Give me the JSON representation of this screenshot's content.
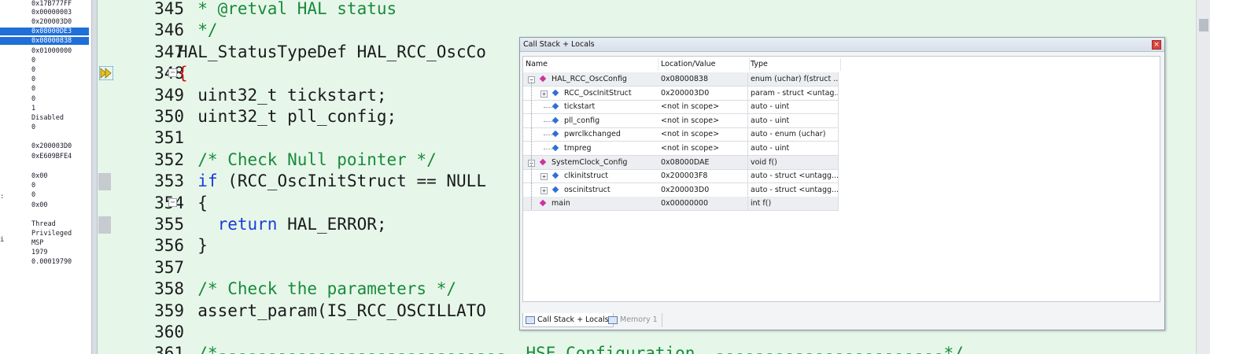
{
  "registers": {
    "lines": [
      {
        "text": "0x17B777FF",
        "selected": false
      },
      {
        "text": "0x00000003",
        "selected": false
      },
      {
        "text": "0x200003D0",
        "selected": false
      },
      {
        "text": "0x08000DE3",
        "selected": true
      },
      {
        "text": "0x08000838",
        "selected": true
      },
      {
        "text": "0x01000000",
        "selected": false
      },
      {
        "text": "0",
        "selected": false
      },
      {
        "text": "0",
        "selected": false
      },
      {
        "text": "0",
        "selected": false
      },
      {
        "text": "0",
        "selected": false
      },
      {
        "text": "0",
        "selected": false
      },
      {
        "text": "1",
        "selected": false
      },
      {
        "text": "Disabled",
        "selected": false
      },
      {
        "text": "0",
        "selected": false
      },
      {
        "text": "",
        "selected": false
      },
      {
        "text": "0x200003D0",
        "selected": false
      },
      {
        "text": "0xE609BFE4",
        "selected": false
      },
      {
        "text": "",
        "selected": false
      },
      {
        "text": "0x00",
        "selected": false
      },
      {
        "text": "0",
        "selected": false
      },
      {
        "text": "0",
        "selected": false
      },
      {
        "text": "0x00",
        "selected": false
      },
      {
        "text": "",
        "selected": false
      },
      {
        "text": "Thread",
        "selected": false
      },
      {
        "text": "Privileged",
        "selected": false
      },
      {
        "text": "MSP",
        "selected": false
      },
      {
        "text": "1979",
        "selected": false
      },
      {
        "text": "0.00019790",
        "selected": false
      }
    ],
    "edge_marks": [
      ":",
      "i"
    ]
  },
  "editor": {
    "lines": [
      {
        "num": "345",
        "fold": "",
        "bp": false,
        "parts": [
          {
            "t": "  * @retval HAL status",
            "c": "comment"
          }
        ]
      },
      {
        "num": "346",
        "fold": "",
        "bp": false,
        "parts": [
          {
            "t": "  */",
            "c": "comment"
          }
        ]
      },
      {
        "num": "347",
        "fold": "",
        "bp": false,
        "parts": [
          {
            "t": "HAL_StatusTypeDef HAL_RCC_OscCo",
            "c": "plain"
          }
        ]
      },
      {
        "num": "348",
        "fold": "−",
        "bp": false,
        "parts": [
          {
            "t": "{",
            "c": "brace"
          }
        ]
      },
      {
        "num": "349",
        "fold": "",
        "bp": false,
        "parts": [
          {
            "t": "  uint32_t tickstart;",
            "c": "plain"
          }
        ]
      },
      {
        "num": "350",
        "fold": "",
        "bp": false,
        "parts": [
          {
            "t": "  uint32_t pll_config;",
            "c": "plain"
          }
        ]
      },
      {
        "num": "351",
        "fold": "",
        "bp": false,
        "parts": [
          {
            "t": "",
            "c": "plain"
          }
        ]
      },
      {
        "num": "352",
        "fold": "",
        "bp": false,
        "parts": [
          {
            "t": "  /* Check Null pointer */",
            "c": "comment"
          }
        ]
      },
      {
        "num": "353",
        "fold": "",
        "bp": true,
        "parts": [
          {
            "t": "  ",
            "c": "plain"
          },
          {
            "t": "if",
            "c": "kw"
          },
          {
            "t": " (RCC_OscInitStruct == NULL",
            "c": "plain"
          }
        ]
      },
      {
        "num": "354",
        "fold": "−",
        "bp": false,
        "parts": [
          {
            "t": "  {",
            "c": "plain"
          }
        ]
      },
      {
        "num": "355",
        "fold": "",
        "bp": true,
        "parts": [
          {
            "t": "    ",
            "c": "plain"
          },
          {
            "t": "return",
            "c": "kw"
          },
          {
            "t": " HAL_ERROR;",
            "c": "plain"
          }
        ]
      },
      {
        "num": "356",
        "fold": "",
        "bp": false,
        "parts": [
          {
            "t": "  }",
            "c": "plain"
          }
        ]
      },
      {
        "num": "357",
        "fold": "",
        "bp": false,
        "parts": [
          {
            "t": "",
            "c": "plain"
          }
        ]
      },
      {
        "num": "358",
        "fold": "",
        "bp": false,
        "parts": [
          {
            "t": "  /* Check the parameters */",
            "c": "comment"
          }
        ]
      },
      {
        "num": "359",
        "fold": "",
        "bp": false,
        "parts": [
          {
            "t": "  assert_param(IS_RCC_OSCILLATO",
            "c": "plain"
          }
        ]
      },
      {
        "num": "360",
        "fold": "",
        "bp": false,
        "parts": [
          {
            "t": "",
            "c": "plain"
          }
        ]
      },
      {
        "num": "361",
        "fold": "",
        "bp": false,
        "parts": [
          {
            "t": "  /*-----------------------------  HSE Configuration  -----------------------*/",
            "c": "comment"
          }
        ]
      }
    ]
  },
  "call_stack_window": {
    "title": "Call Stack + Locals",
    "close_glyph": "×",
    "columns": [
      "Name",
      "Location/Value",
      "Type"
    ],
    "rows": [
      {
        "depth": 0,
        "expander": "−",
        "kind": "func",
        "name": "HAL_RCC_OscConfig",
        "value": "0x08000838",
        "type": "enum (uchar) f(struct ...",
        "shaded": true
      },
      {
        "depth": 1,
        "expander": "+",
        "kind": "var",
        "name": "RCC_OscInitStruct",
        "value": "0x200003D0",
        "type": "param - struct <untag...",
        "shaded": false
      },
      {
        "depth": 1,
        "expander": "",
        "kind": "var",
        "name": "tickstart",
        "value": "<not in scope>",
        "type": "auto - uint",
        "shaded": false
      },
      {
        "depth": 1,
        "expander": "",
        "kind": "var",
        "name": "pll_config",
        "value": "<not in scope>",
        "type": "auto - uint",
        "shaded": false
      },
      {
        "depth": 1,
        "expander": "",
        "kind": "var",
        "name": "pwrclkchanged",
        "value": "<not in scope>",
        "type": "auto - enum (uchar)",
        "shaded": false
      },
      {
        "depth": 1,
        "expander": "",
        "kind": "var",
        "name": "tmpreg",
        "value": "<not in scope>",
        "type": "auto - uint",
        "shaded": false
      },
      {
        "depth": 0,
        "expander": "−",
        "kind": "func",
        "name": "SystemClock_Config",
        "value": "0x08000DAE",
        "type": "void f()",
        "shaded": true
      },
      {
        "depth": 1,
        "expander": "+",
        "kind": "var",
        "name": "clkinitstruct",
        "value": "0x200003F8",
        "type": "auto - struct <untagg...",
        "shaded": false
      },
      {
        "depth": 1,
        "expander": "+",
        "kind": "var",
        "name": "oscinitstruct",
        "value": "0x200003D0",
        "type": "auto - struct <untagg...",
        "shaded": false
      },
      {
        "depth": 0,
        "expander": "",
        "kind": "func",
        "name": "main",
        "value": "0x00000000",
        "type": "int f()",
        "shaded": true
      }
    ],
    "tabs": [
      {
        "label": "Call Stack + Locals",
        "active": true
      },
      {
        "label": "Memory 1",
        "active": false
      }
    ]
  },
  "colors": {
    "editor_bg": "#e6f7ea",
    "comment": "#1a8a3a",
    "keyword": "#1a3bd8",
    "brace": "#d01010",
    "register_selection": "#1f6fd8",
    "exec_arrow": "#e9c21a"
  },
  "icons": {
    "exec_arrow": "execution-arrow-icon",
    "func_node": "function-diamond-icon",
    "var_node": "variable-diamond-icon"
  }
}
